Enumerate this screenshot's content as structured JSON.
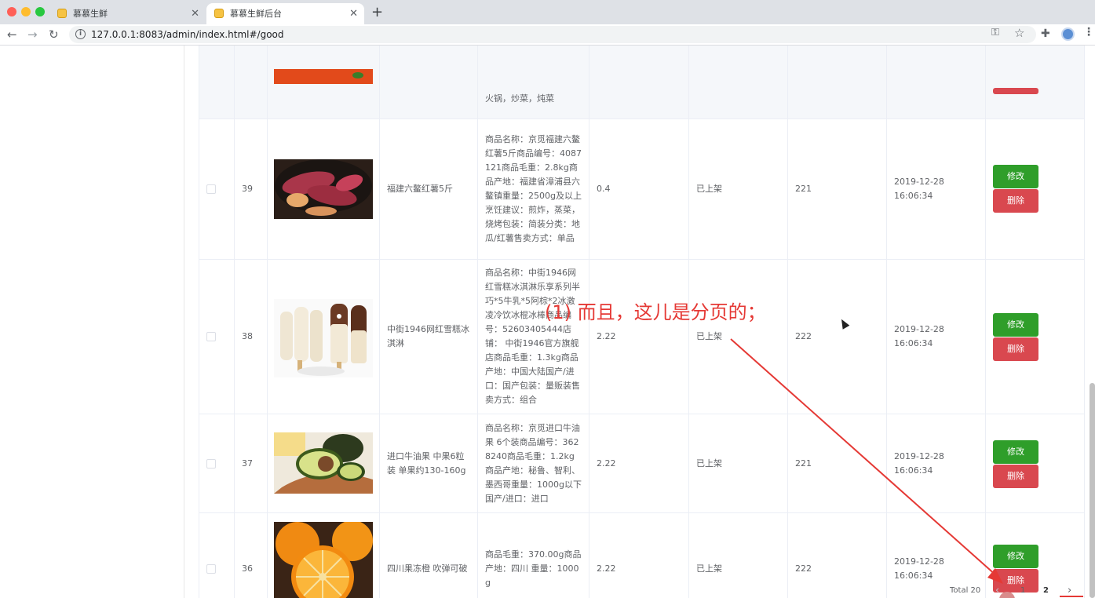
{
  "browser": {
    "tabs": [
      {
        "title": "慕慕生鲜",
        "active": false
      },
      {
        "title": "慕慕生鲜后台",
        "active": true
      }
    ],
    "new_tab_symbol": "+",
    "url": "127.0.0.1:8083/admin/index.html#/good"
  },
  "top_row": {
    "description_tail": "火锅，炒菜，炖菜"
  },
  "rows": [
    {
      "id": "39",
      "name": "福建六鳌红薯5斤",
      "description": "商品名称：京觅福建六鳌红薯5斤商品编号：4087121商品毛重：2.8kg商品产地：福建省漳浦县六鳌镇重量：2500g及以上烹饪建议：煎炸，蒸菜，烧烤包装：简装分类：地瓜/红薯售卖方式：单品",
      "price": "0.4",
      "status": "已上架",
      "stock": "221",
      "time": "2019-12-28 16:06:34",
      "image": "sweet-potato-image"
    },
    {
      "id": "38",
      "name": "中街1946网红雪糕冰淇淋",
      "description": "商品名称：中街1946网红雪糕冰淇淋乐享系列半巧*5牛乳*5阿棕*2冰激凌冷饮冰棍冰棒商品编号：52603405444店铺： 中街1946官方旗舰店商品毛重：1.3kg商品产地：中国大陆国产/进口：国产包装：量贩装售卖方式：组合",
      "price": "2.22",
      "status": "已上架",
      "stock": "222",
      "time": "2019-12-28 16:06:34",
      "image": "ice-cream-image"
    },
    {
      "id": "37",
      "name": "进口牛油果 中果6粒装 单果约130-160g",
      "description": "商品名称：京觅进口牛油果 6个装商品编号：3628240商品毛重：1.2kg商品产地：秘鲁、智利、墨西哥重量：1000g以下国产/进口：进口",
      "price": "2.22",
      "status": "已上架",
      "stock": "221",
      "time": "2019-12-28 16:06:34",
      "image": "avocado-image"
    },
    {
      "id": "36",
      "name": "四川果冻橙 吹弹可破",
      "description": "商品毛重：370.00g商品产地：四川 重量：1000g",
      "price": "2.22",
      "status": "已上架",
      "stock": "222",
      "time": "2019-12-28 16:06:34",
      "image": "orange-image"
    }
  ],
  "buttons": {
    "edit": "修改",
    "delete": "删除"
  },
  "pagination": {
    "total": "Total 20",
    "prev": "‹",
    "pages": [
      "1",
      "2"
    ],
    "current": "2",
    "next": "›"
  },
  "annotation": {
    "text": "(1) 而且，这儿是分页的；"
  },
  "colors": {
    "edit_button": "#2f9e2a",
    "delete_button": "#d9484f",
    "annotation": "#e53935"
  }
}
